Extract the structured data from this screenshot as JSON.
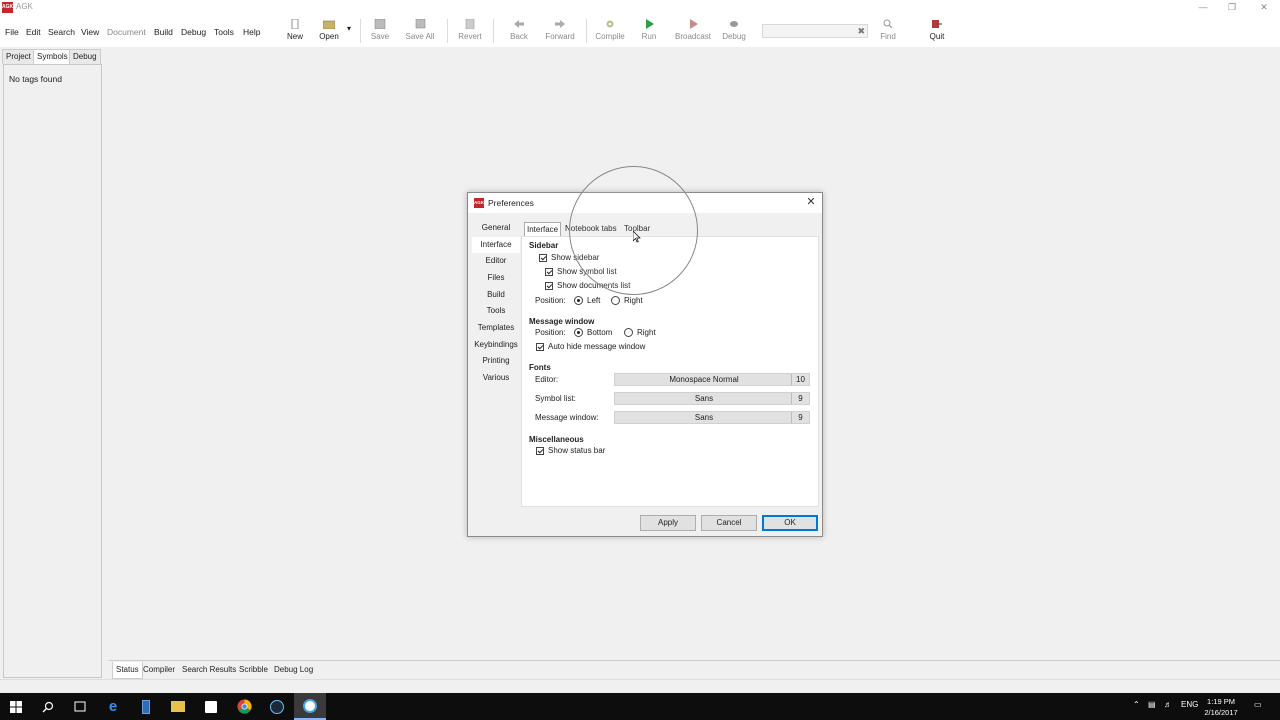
{
  "window": {
    "title": "AGK",
    "app_icon_text": "AGK"
  },
  "menu": [
    "File",
    "Edit",
    "Search",
    "View",
    "Document",
    "Build",
    "Debug",
    "Tools",
    "Help"
  ],
  "toolbar": {
    "new": "New",
    "open": "Open",
    "save": "Save",
    "save_all": "Save All",
    "revert": "Revert",
    "back": "Back",
    "forward": "Forward",
    "compile": "Compile",
    "run": "Run",
    "broadcast": "Broadcast",
    "debug": "Debug",
    "find": "Find",
    "quit": "Quit",
    "search_value": ""
  },
  "sidebar": {
    "tabs": [
      "Project",
      "Symbols",
      "Debug"
    ],
    "active_tab": "Symbols",
    "empty_text": "No tags found"
  },
  "message_tabs": [
    "Status",
    "Compiler",
    "Search Results",
    "Scribble",
    "Debug Log"
  ],
  "dialog": {
    "title": "Preferences",
    "categories": [
      "General",
      "Interface",
      "Editor",
      "Files",
      "Build",
      "Tools",
      "Templates",
      "Keybindings",
      "Printing",
      "Various"
    ],
    "active_category": "Interface",
    "subtabs": [
      "Interface",
      "Notebook tabs",
      "Toolbar"
    ],
    "sidebar": {
      "heading": "Sidebar",
      "show_sidebar": "Show sidebar",
      "show_symbol_list": "Show symbol list",
      "show_documents_list": "Show documents list",
      "position_label": "Position:",
      "left": "Left",
      "right": "Right"
    },
    "message_window": {
      "heading": "Message window",
      "position_label": "Position:",
      "bottom": "Bottom",
      "right": "Right",
      "auto_hide": "Auto hide message window"
    },
    "fonts": {
      "heading": "Fonts",
      "editor_label": "Editor:",
      "editor_font": "Monospace Normal",
      "editor_size": "10",
      "symbol_label": "Symbol list:",
      "symbol_font": "Sans",
      "symbol_size": "9",
      "message_label": "Message window:",
      "message_font": "Sans",
      "message_size": "9"
    },
    "misc": {
      "heading": "Miscellaneous",
      "show_status_bar": "Show status bar"
    },
    "buttons": {
      "apply": "Apply",
      "cancel": "Cancel",
      "ok": "OK"
    }
  },
  "taskbar": {
    "lang": "ENG",
    "time": "1:19 PM",
    "date": "2/16/2017"
  },
  "colors": {
    "accent": "#0078d7",
    "app_icon": "#c0282e",
    "run_green": "#2e9e3e"
  }
}
